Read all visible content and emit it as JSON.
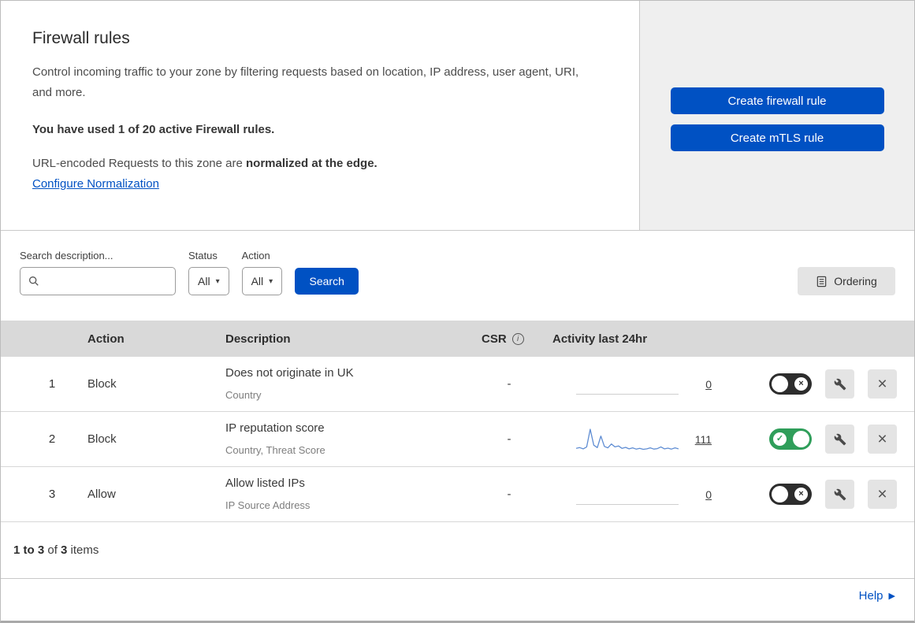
{
  "colors": {
    "primary_blue": "#0051c3",
    "link_blue": "#0051c3",
    "toggle_on_green": "#2f9e5a",
    "toggle_off_dark": "#2d2d2d",
    "sparkline_blue": "#5f8dd3",
    "table_header_bg": "#d9d9d9",
    "side_panel_bg": "#efefef"
  },
  "icons": {
    "info": "i",
    "caret": "▾",
    "close": "×",
    "check": "✓",
    "help_arrow": "▶"
  },
  "header": {
    "title": "Firewall rules",
    "description": "Control incoming traffic to your zone by filtering requests based on location, IP address, user agent, URI, and more.",
    "usage_note": "You have used 1 of 20 active Firewall rules.",
    "normalization_text": "URL-encoded Requests to this zone are ",
    "normalization_bold": "normalized at the edge.",
    "normalization_link": "Configure Normalization",
    "create_firewall_rule": "Create firewall rule",
    "create_mtls_rule": "Create mTLS rule"
  },
  "filters": {
    "search_label": "Search description...",
    "status_label": "Status",
    "status_value": "All",
    "action_label": "Action",
    "action_value": "All",
    "search_button": "Search",
    "ordering_button": "Ordering"
  },
  "table": {
    "headers": {
      "action": "Action",
      "description": "Description",
      "csr": "CSR",
      "activity": "Activity last 24hr"
    },
    "rows": [
      {
        "number": "1",
        "action": "Block",
        "description": "Does not originate in UK",
        "criteria": "Country",
        "csr": "-",
        "activity_count": "0",
        "enabled": false
      },
      {
        "number": "2",
        "action": "Block",
        "description": "IP reputation score",
        "criteria": "Country, Threat Score",
        "csr": "-",
        "activity_count": "111",
        "enabled": true,
        "sparkline": [
          12,
          15,
          10,
          18,
          90,
          25,
          15,
          62,
          20,
          14,
          30,
          18,
          22,
          12,
          16,
          10,
          14,
          9,
          12,
          8,
          10,
          14,
          9,
          11,
          18,
          10,
          13,
          9,
          14,
          10
        ]
      },
      {
        "number": "3",
        "action": "Allow",
        "description": "Allow listed IPs",
        "criteria": "IP Source Address",
        "csr": "-",
        "activity_count": "0",
        "enabled": false
      }
    ]
  },
  "footer": {
    "range": "1 to 3",
    "of": " of ",
    "total": "3",
    "items": " items",
    "help": "Help"
  }
}
